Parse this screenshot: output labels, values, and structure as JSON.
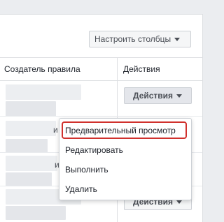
{
  "toolbar": {
    "configure_columns_label": "Настроить столбцы"
  },
  "table": {
    "headers": {
      "rule_creator": "Создатель правила",
      "actions": "Действия"
    },
    "row_stub": "и",
    "actions_button_label": "Действия"
  },
  "actions_menu": {
    "items": [
      "Предварительный просмотр",
      "Редактировать",
      "Выполнить",
      "Удалить"
    ]
  },
  "colors": {
    "highlight": "#d0312d",
    "divider": "#dddfe2"
  }
}
